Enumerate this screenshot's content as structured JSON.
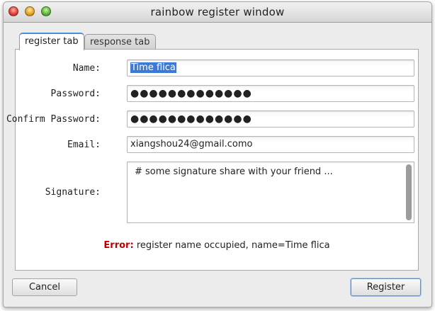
{
  "window": {
    "title": "rainbow register window"
  },
  "tabs": [
    {
      "label": "register tab",
      "active": true
    },
    {
      "label": "response tab",
      "active": false
    }
  ],
  "form": {
    "name_label": "Name:",
    "name_value": "Time flica",
    "password_label": "Password:",
    "password_value": "●●●●●●●●●●●●●",
    "confirm_label": "Confirm Password:",
    "confirm_value": "●●●●●●●●●●●●●",
    "email_label": "Email:",
    "email_value": "xiangshou24@gmail.como",
    "signature_label": "Signature:",
    "signature_value": "# some signature share with your friend ..."
  },
  "error": {
    "prefix": "Error:",
    "message": "register name occupied, name=Time flica",
    "prefix_color": "#c00000"
  },
  "buttons": {
    "cancel": "Cancel",
    "register": "Register"
  },
  "colors": {
    "selection": "#3d7ad6",
    "active_tab_accent": "#4b8fd9"
  }
}
